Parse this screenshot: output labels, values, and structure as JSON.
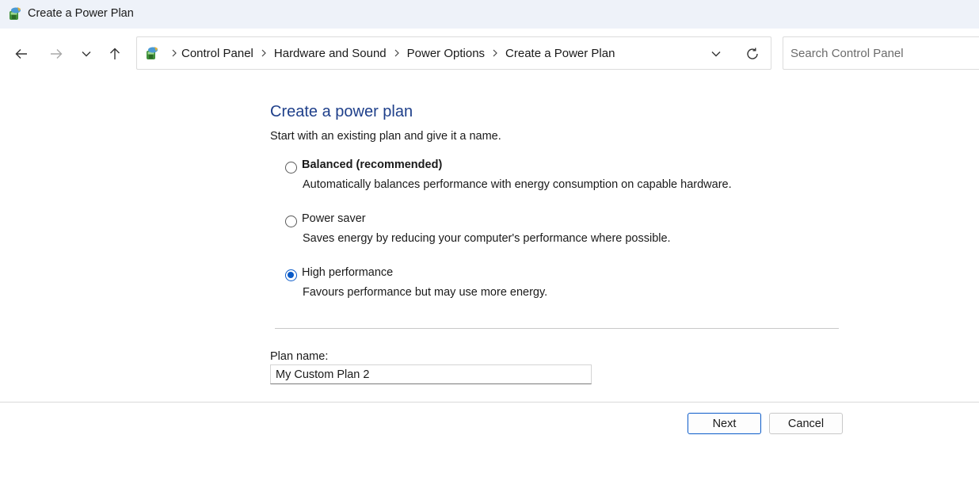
{
  "window": {
    "title": "Create a Power Plan"
  },
  "nav": {
    "back_icon": "arrow-left-icon",
    "forward_icon": "arrow-right-icon",
    "recent_icon": "chevron-down-icon",
    "up_icon": "arrow-up-icon"
  },
  "address_bar": {
    "breadcrumbs": [
      "Control Panel",
      "Hardware and Sound",
      "Power Options",
      "Create a Power Plan"
    ],
    "dropdown_icon": "chevron-down-icon",
    "refresh_icon": "refresh-icon"
  },
  "search": {
    "placeholder": "Search Control Panel",
    "value": ""
  },
  "main": {
    "heading": "Create a power plan",
    "subtext": "Start with an existing plan and give it a name.",
    "options": [
      {
        "label": "Balanced (recommended)",
        "description": "Automatically balances performance with energy consumption on capable hardware.",
        "selected": false
      },
      {
        "label": "Power saver",
        "description": "Saves energy by reducing your computer's performance where possible.",
        "selected": false
      },
      {
        "label": "High performance",
        "description": "Favours performance but may use more energy.",
        "selected": true
      }
    ],
    "plan_name_label": "Plan name:",
    "plan_name_value": "My Custom Plan 2"
  },
  "buttons": {
    "next": "Next",
    "cancel": "Cancel"
  },
  "colors": {
    "heading": "#1e3f8a",
    "accent": "#0a5ac8",
    "titlebar_bg": "#eef2f9"
  }
}
